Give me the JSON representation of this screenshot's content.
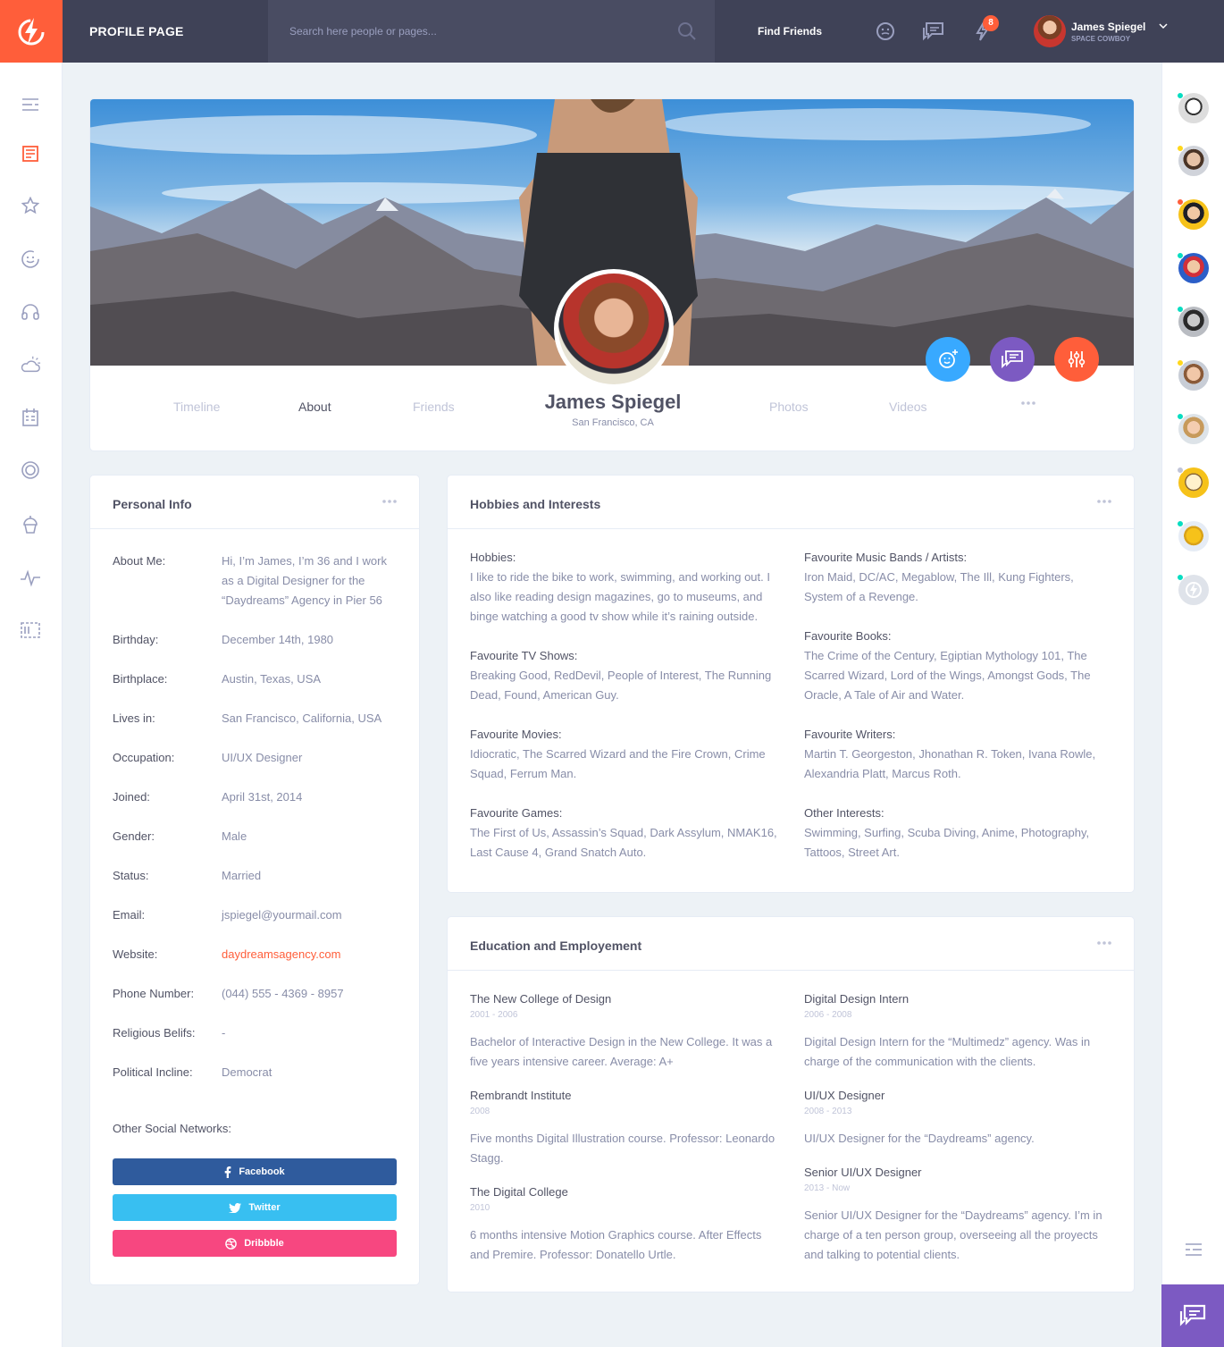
{
  "header": {
    "page_title": "PROFILE PAGE",
    "search_placeholder": "Search here people or pages...",
    "find_friends": "Find Friends",
    "notification_count": "8",
    "user_name": "James Spiegel",
    "user_subtitle": "SPACE COWBOY"
  },
  "profile": {
    "name": "James Spiegel",
    "location": "San Francisco, CA",
    "tabs": [
      "Timeline",
      "About",
      "Friends",
      "Photos",
      "Videos"
    ],
    "active_tab": "About"
  },
  "personal_info": {
    "title": "Personal Info",
    "rows": [
      {
        "label": "About Me:",
        "value": "Hi, I’m James, I’m 36 and I work as a Digital Designer for the “Daydreams” Agency in Pier 56"
      },
      {
        "label": "Birthday:",
        "value": "December 14th, 1980"
      },
      {
        "label": "Birthplace:",
        "value": "Austin, Texas, USA"
      },
      {
        "label": "Lives in:",
        "value": "San Francisco, California, USA"
      },
      {
        "label": "Occupation:",
        "value": "UI/UX Designer"
      },
      {
        "label": "Joined:",
        "value": "April 31st, 2014"
      },
      {
        "label": "Gender:",
        "value": "Male"
      },
      {
        "label": "Status:",
        "value": "Married"
      },
      {
        "label": "Email:",
        "value": "jspiegel@yourmail.com"
      },
      {
        "label": "Website:",
        "value": "daydreamsagency.com"
      },
      {
        "label": "Phone Number:",
        "value": "(044) 555 - 4369 - 8957"
      },
      {
        "label": "Religious Belifs:",
        "value": "-"
      },
      {
        "label": "Political Incline:",
        "value": "Democrat"
      }
    ],
    "social_title": "Other Social Networks:",
    "social": [
      {
        "label": "Facebook",
        "color": "#2f5b9d",
        "icon": "facebook-icon"
      },
      {
        "label": "Twitter",
        "color": "#38bff1",
        "icon": "twitter-icon"
      },
      {
        "label": "Dribbble",
        "color": "#f74780",
        "icon": "dribbble-icon"
      }
    ]
  },
  "hobbies": {
    "title": "Hobbies and Interests",
    "left": [
      {
        "title": "Hobbies:",
        "text": "I like to ride the bike to work, swimming, and working out. I also like reading design magazines, go to museums, and binge watching a good tv show while it’s raining outside."
      },
      {
        "title": "Favourite TV Shows:",
        "text": "Breaking Good, RedDevil, People of Interest, The Running Dead, Found,  American Guy."
      },
      {
        "title": "Favourite Movies:",
        "text": "Idiocratic, The Scarred Wizard and the Fire Crown,  Crime Squad, Ferrum Man."
      },
      {
        "title": "Favourite Games:",
        "text": "The First of Us, Assassin’s Squad, Dark Assylum, NMAK16, Last Cause 4, Grand Snatch Auto."
      }
    ],
    "right": [
      {
        "title": "Favourite Music Bands / Artists:",
        "text": "Iron Maid, DC/AC, Megablow, The Ill, Kung Fighters, System of a Revenge."
      },
      {
        "title": "Favourite Books:",
        "text": "The Crime of the Century, Egiptian Mythology 101, The Scarred Wizard, Lord of the Wings, Amongst Gods, The Oracle, A Tale of Air and Water."
      },
      {
        "title": "Favourite Writers:",
        "text": "Martin T. Georgeston, Jhonathan R. Token, Ivana Rowle, Alexandria Platt, Marcus Roth."
      },
      {
        "title": "Other Interests:",
        "text": "Swimming, Surfing, Scuba Diving, Anime, Photography, Tattoos, Street Art."
      }
    ]
  },
  "education": {
    "title": "Education and Employement",
    "left": [
      {
        "title": "The New College of Design",
        "date": "2001 - 2006",
        "text": "Bachelor of Interactive Design in the New College. It was a five years intensive career. Average: A+"
      },
      {
        "title": "Rembrandt Institute",
        "date": "2008",
        "text": "Five months Digital Illustration course. Professor: Leonardo Stagg."
      },
      {
        "title": "The Digital College",
        "date": "2010",
        "text": "6 months intensive Motion Graphics course. After Effects and Premire. Professor: Donatello Urtle."
      }
    ],
    "right": [
      {
        "title": "Digital Design Intern",
        "date": "2006 - 2008",
        "text": "Digital Design Intern for the “Multimedz” agency. Was in charge of the communication with the clients."
      },
      {
        "title": "UI/UX Designer",
        "date": "2008 - 2013",
        "text": "UI/UX Designer for the “Daydreams” agency."
      },
      {
        "title": "Senior UI/UX Designer",
        "date": "2013 - Now",
        "text": "Senior UI/UX Designer for the “Daydreams” agency. I’m in charge of a ten person group, overseeing all the proyects and talking to potential clients."
      }
    ]
  },
  "colors": {
    "accent": "#ff5e3a",
    "purple": "#7c5ac2",
    "blue": "#38a9ff",
    "dark": "#3f4257"
  }
}
